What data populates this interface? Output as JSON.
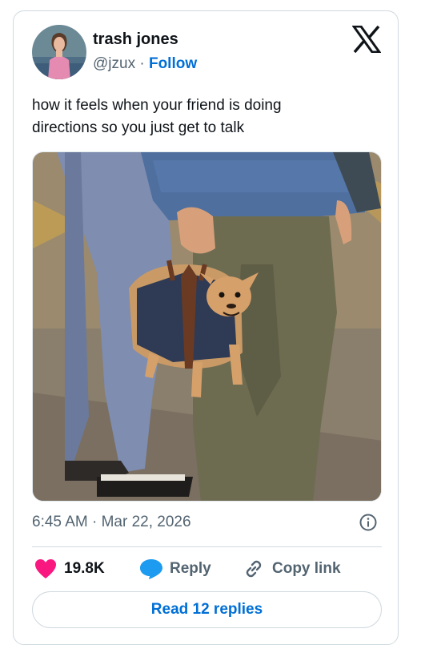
{
  "author": {
    "name": "trash jones",
    "handle": "@jzux",
    "separator": "·",
    "follow_label": "Follow"
  },
  "tweet": {
    "text_line1": "how it feels when your friend is doing",
    "text_line2": "directions so you just get to talk",
    "time": "6:45 AM",
    "separator": "·",
    "date": "Mar 22, 2026"
  },
  "actions": {
    "likes": "19.8K",
    "reply_label": "Reply",
    "copy_label": "Copy link",
    "read_replies_label": "Read 12 replies"
  },
  "icons": {
    "platform": "x-logo-icon",
    "info": "info-icon",
    "like": "heart-icon",
    "reply": "speech-bubble-icon",
    "copy": "link-icon"
  },
  "colors": {
    "accent": "#006fd6",
    "like": "#f91880",
    "reply_icon": "#1d9bf0",
    "text_secondary": "#536471",
    "border": "#cfd9de"
  }
}
